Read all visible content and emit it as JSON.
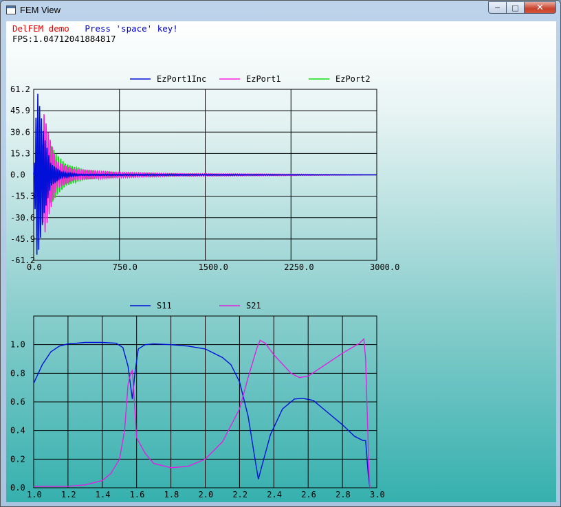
{
  "window": {
    "title": "FEM View",
    "buttons": {
      "minimize": "─",
      "maximize": "□",
      "close": "✕"
    }
  },
  "header": {
    "demo_label": "DelFEM demo",
    "hint": "Press 'space' key!",
    "fps": "FPS:1.04712041884817"
  },
  "colors": {
    "ezport1inc": "#0010d8",
    "ezport1": "#ff20e0",
    "ezport2": "#10e010",
    "s11": "#0010d8",
    "s21": "#e020e0"
  },
  "chart_data": [
    {
      "type": "line",
      "xlim": [
        0,
        3000
      ],
      "ylim": [
        -61.2,
        61.2
      ],
      "x_ticks": [
        "0.0",
        "750.0",
        "1500.0",
        "2250.0",
        "3000.0"
      ],
      "y_ticks": [
        "61.2",
        "45.9",
        "30.6",
        "15.3",
        "0.0",
        "-15.3",
        "-30.6",
        "-45.9",
        "-61.2"
      ],
      "grid": true,
      "legend": "top",
      "series": [
        {
          "name": "EzPort1Inc",
          "envelope": [
            [
              0,
              0
            ],
            [
              30,
              61.2
            ],
            [
              60,
              45
            ],
            [
              90,
              28
            ],
            [
              150,
              8
            ],
            [
              250,
              2
            ],
            [
              400,
              0.5
            ],
            [
              3000,
              0
            ]
          ]
        },
        {
          "name": "EzPort1",
          "envelope": [
            [
              0,
              0
            ],
            [
              60,
              5
            ],
            [
              90,
              45
            ],
            [
              130,
              30
            ],
            [
              200,
              10
            ],
            [
              350,
              4
            ],
            [
              700,
              2
            ],
            [
              1200,
              1
            ],
            [
              2100,
              0.6
            ],
            [
              3000,
              0
            ]
          ]
        },
        {
          "name": "EzPort2",
          "envelope": [
            [
              0,
              0
            ],
            [
              110,
              5
            ],
            [
              150,
              22
            ],
            [
              200,
              15
            ],
            [
              280,
              8
            ],
            [
              450,
              3
            ],
            [
              800,
              1.2
            ],
            [
              1500,
              0.5
            ],
            [
              3000,
              0
            ]
          ]
        }
      ]
    },
    {
      "type": "line",
      "xlim": [
        1.0,
        3.0
      ],
      "ylim": [
        0.0,
        1.2
      ],
      "x_ticks": [
        "1.0",
        "1.2",
        "1.4",
        "1.6",
        "1.8",
        "2.0",
        "2.2",
        "2.4",
        "2.6",
        "2.8",
        "3.0"
      ],
      "y_ticks": [
        "1.0",
        "0.8",
        "0.6",
        "0.4",
        "0.2",
        "0.0"
      ],
      "grid": true,
      "legend": "top",
      "series": [
        {
          "name": "S11",
          "points": [
            [
              1.0,
              0.73
            ],
            [
              1.05,
              0.86
            ],
            [
              1.1,
              0.95
            ],
            [
              1.15,
              0.99
            ],
            [
              1.2,
              1.005
            ],
            [
              1.3,
              1.015
            ],
            [
              1.4,
              1.015
            ],
            [
              1.48,
              1.01
            ],
            [
              1.52,
              0.98
            ],
            [
              1.55,
              0.85
            ],
            [
              1.575,
              0.62
            ],
            [
              1.59,
              0.8
            ],
            [
              1.61,
              0.97
            ],
            [
              1.65,
              1.0
            ],
            [
              1.7,
              1.005
            ],
            [
              1.8,
              1.0
            ],
            [
              1.9,
              0.99
            ],
            [
              2.0,
              0.97
            ],
            [
              2.1,
              0.91
            ],
            [
              2.15,
              0.86
            ],
            [
              2.2,
              0.74
            ],
            [
              2.25,
              0.5
            ],
            [
              2.29,
              0.2
            ],
            [
              2.31,
              0.06
            ],
            [
              2.33,
              0.15
            ],
            [
              2.38,
              0.37
            ],
            [
              2.45,
              0.55
            ],
            [
              2.52,
              0.62
            ],
            [
              2.57,
              0.625
            ],
            [
              2.63,
              0.61
            ],
            [
              2.7,
              0.54
            ],
            [
              2.8,
              0.44
            ],
            [
              2.87,
              0.36
            ],
            [
              2.92,
              0.33
            ],
            [
              2.935,
              0.33
            ],
            [
              2.95,
              0.1
            ],
            [
              2.96,
              0.0
            ]
          ]
        },
        {
          "name": "S21",
          "points": [
            [
              1.0,
              0.01
            ],
            [
              1.2,
              0.01
            ],
            [
              1.3,
              0.02
            ],
            [
              1.4,
              0.05
            ],
            [
              1.45,
              0.1
            ],
            [
              1.5,
              0.2
            ],
            [
              1.53,
              0.4
            ],
            [
              1.55,
              0.72
            ],
            [
              1.565,
              0.8
            ],
            [
              1.575,
              0.82
            ],
            [
              1.59,
              0.55
            ],
            [
              1.6,
              0.35
            ],
            [
              1.65,
              0.24
            ],
            [
              1.7,
              0.17
            ],
            [
              1.8,
              0.14
            ],
            [
              1.9,
              0.15
            ],
            [
              2.0,
              0.2
            ],
            [
              2.1,
              0.32
            ],
            [
              2.2,
              0.55
            ],
            [
              2.25,
              0.77
            ],
            [
              2.3,
              0.97
            ],
            [
              2.32,
              1.03
            ],
            [
              2.35,
              1.01
            ],
            [
              2.4,
              0.93
            ],
            [
              2.5,
              0.8
            ],
            [
              2.55,
              0.77
            ],
            [
              2.6,
              0.78
            ],
            [
              2.7,
              0.86
            ],
            [
              2.8,
              0.94
            ],
            [
              2.9,
              1.01
            ],
            [
              2.925,
              1.04
            ],
            [
              2.935,
              0.9
            ],
            [
              2.945,
              0.5
            ],
            [
              2.955,
              0.1
            ],
            [
              2.96,
              0.0
            ]
          ]
        }
      ]
    }
  ]
}
